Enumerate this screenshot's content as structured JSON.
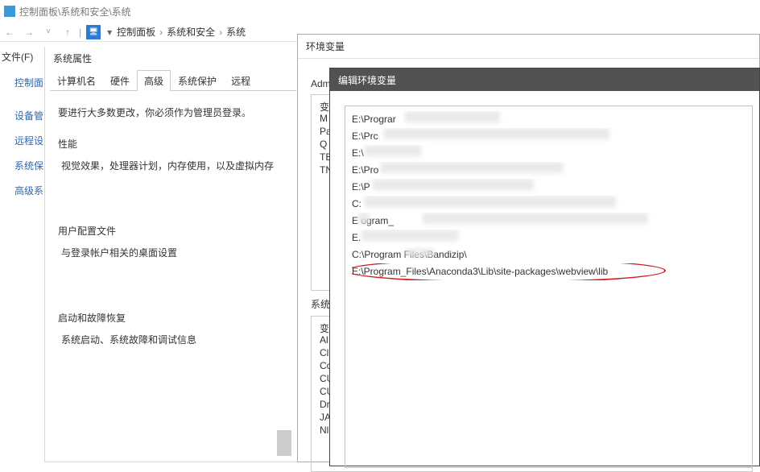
{
  "window": {
    "title": "控制面板\\系统和安全\\系统"
  },
  "addrbar": {
    "seg1": "控制面板",
    "seg2": "系统和安全",
    "seg3": "系统"
  },
  "menu": {
    "file": "文件(F)"
  },
  "leftcol": {
    "i0": "控制面",
    "i1": "设备管",
    "i2": "远程设",
    "i3": "系统保",
    "i4": "高级系"
  },
  "props": {
    "title": "系统属性",
    "tabs": {
      "t0": "计算机名",
      "t1": "硬件",
      "t2": "高级",
      "t3": "系统保护",
      "t4": "远程"
    },
    "admin_line": "要进行大多数更改，你必须作为管理员登录。",
    "s1": {
      "title": "性能",
      "sub": "视觉效果，处理器计划，内存使用，以及虚拟内存"
    },
    "s2": {
      "title": "用户配置文件",
      "sub": "与登录帐户相关的桌面设置"
    },
    "s3": {
      "title": "启动和故障恢复",
      "sub": "系统启动、系统故障和调试信息"
    }
  },
  "env": {
    "title": "环境变量",
    "user_label": "Adm",
    "sys_label": "系统",
    "ucol": "变",
    "uvals": {
      "r0": "M",
      "r1": "Pa",
      "r2": "Q",
      "r3": "TE",
      "r4": "TN"
    },
    "scol": "变",
    "svals": {
      "r0": "Al",
      "r1": "Cl",
      "r2": "Cc",
      "r3": "CU",
      "r4": "CU",
      "r5": "Dr",
      "r6": "JA",
      "r7": "Nl"
    }
  },
  "edit": {
    "title": "编辑环境变量",
    "rows": {
      "r0": "E:\\Prograr",
      "r1": "E:\\Prc",
      "r2": "E:\\",
      "r3": "E:\\Pro",
      "r4": "E:\\P",
      "r5": "C:",
      "r6": "E       ogram_",
      "r7": "E.",
      "r8": "C:\\Program  Files\\Bandizip\\",
      "r9": "E:\\Program_Files\\Anaconda3\\Lib\\site-packages\\webview\\lib"
    }
  }
}
